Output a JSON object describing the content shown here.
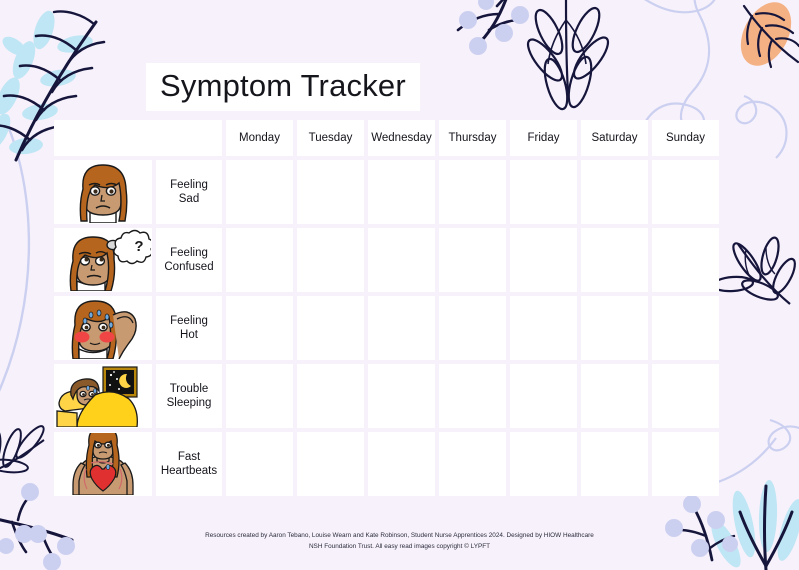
{
  "document": {
    "title": "Symptom Tracker",
    "background_color": "#f7f1fb",
    "cell_color": "#ffffff"
  },
  "table": {
    "corner_header": "",
    "day_headers": [
      "Monday",
      "Tuesday",
      "Wednesday",
      "Thursday",
      "Friday",
      "Saturday",
      "Sunday"
    ],
    "rows": [
      {
        "image": "sad-face-image",
        "label": "Feeling\nSad",
        "label_line1": "Feeling",
        "label_line2": "Sad",
        "cells": [
          "",
          "",
          "",
          "",
          "",
          "",
          ""
        ]
      },
      {
        "image": "confused-face-image",
        "label": "Feeling\nConfused",
        "label_line1": "Feeling",
        "label_line2": "Confused",
        "cells": [
          "",
          "",
          "",
          "",
          "",
          "",
          ""
        ]
      },
      {
        "image": "hot-flush-image",
        "label": "Feeling\nHot",
        "label_line1": "Feeling",
        "label_line2": "Hot",
        "cells": [
          "",
          "",
          "",
          "",
          "",
          "",
          ""
        ]
      },
      {
        "image": "trouble-sleeping-image",
        "label": "Trouble\nSleeping",
        "label_line1": "Trouble",
        "label_line2": "Sleeping",
        "cells": [
          "",
          "",
          "",
          "",
          "",
          "",
          ""
        ]
      },
      {
        "image": "fast-heartbeat-image",
        "label": "Fast\nHeartbeats",
        "label_line1": "Fast",
        "label_line2": "Heartbeats",
        "cells": [
          "",
          "",
          "",
          "",
          "",
          "",
          ""
        ]
      }
    ]
  },
  "footer": {
    "line1": "Resources created by Aaron Tebano, Louise Wearn and Kate Robinson, Student Nurse Apprentices 2024. Designed by HIOW Healthcare",
    "line2": "NSH Foundation Trust. All easy read images copyright © LYPFT"
  },
  "decorations": {
    "palette": {
      "navy": "#16163c",
      "light_blue": "#bfe6f4",
      "periwinkle": "#ccd0f0",
      "orange": "#f4b183",
      "background": "#f7f1fb"
    },
    "items": [
      "top-left-leafy-branch",
      "top-center-berry-branch",
      "top-center-outline-leaf",
      "top-right-curly-line",
      "top-right-orange-leaf",
      "right-outline-leaf",
      "bottom-right-curly-line",
      "bottom-right-blue-grass",
      "bottom-right-berry-sprig",
      "left-outline-leaf",
      "bottom-left-berry-branch",
      "left-edge-curve"
    ]
  }
}
